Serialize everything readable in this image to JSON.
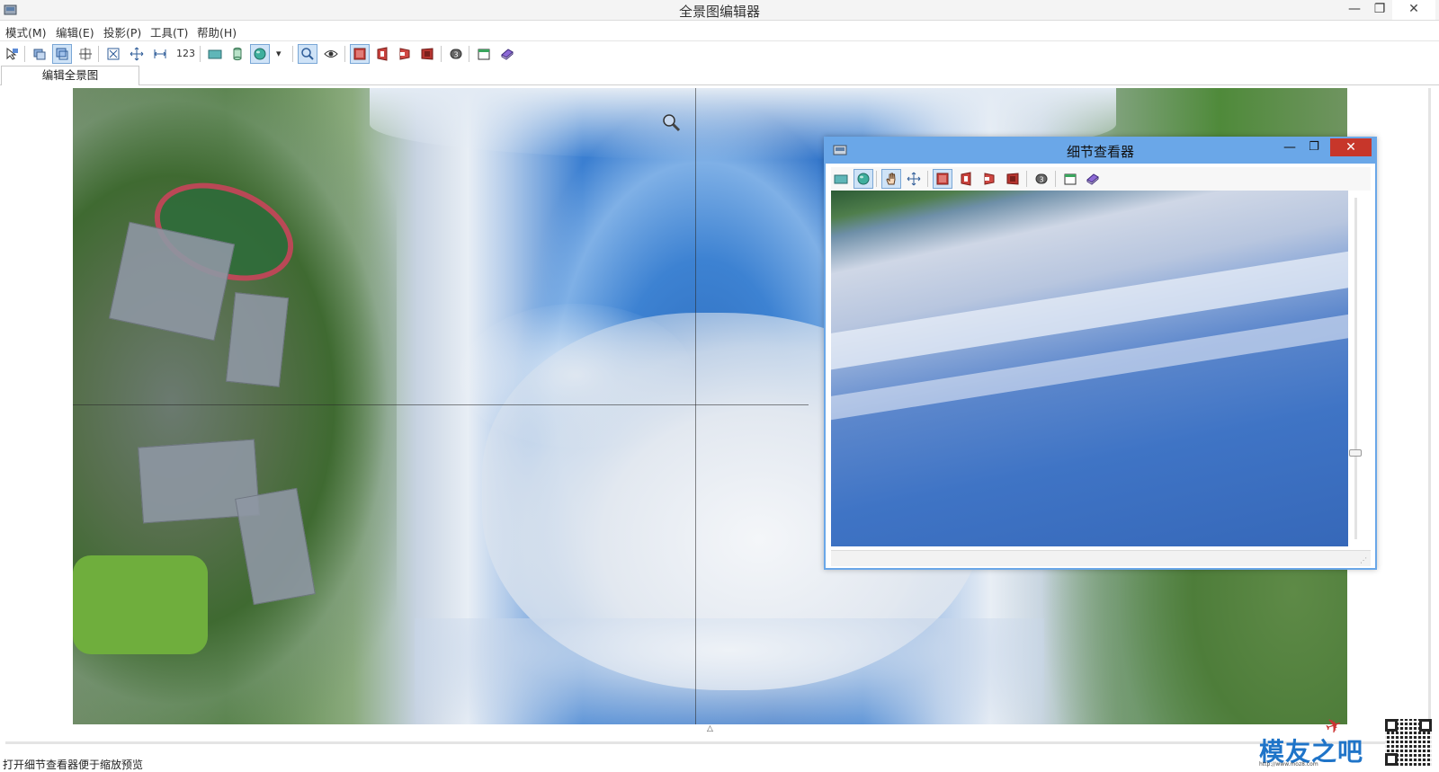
{
  "window": {
    "title": "全景图编辑器",
    "min_glyph": "—",
    "max_glyph": "❐",
    "close_glyph": "✕"
  },
  "menu": {
    "items": [
      {
        "label": "模式(M)"
      },
      {
        "label": "编辑(E)"
      },
      {
        "label": "投影(P)"
      },
      {
        "label": "工具(T)"
      },
      {
        "label": "帮助(H)"
      }
    ]
  },
  "toolbar": {
    "count_label": "123",
    "dropdown_glyph": "▾",
    "icons": [
      "pointer-select-icon",
      "layers-icon",
      "overlay-icon",
      "crosshair-grid-icon",
      "fit-view-icon",
      "move-arrows-icon",
      "spread-icon",
      "numbering-icon",
      "flat-projection-icon",
      "cylinder-projection-icon",
      "sphere-projection-icon",
      "projection-dropdown-icon",
      "zoom-icon",
      "eye-icon",
      "color-box-1-icon",
      "color-box-2-icon",
      "color-box-3-icon",
      "color-box-4-icon",
      "badge-3-icon",
      "window-green-icon",
      "book-icon"
    ],
    "accent_color": "#cfe3f7"
  },
  "tabs": [
    {
      "label": "编辑全景图",
      "active": true
    }
  ],
  "status": {
    "message": "打开细节查看器便于缩放预览"
  },
  "detail_viewer": {
    "title": "细节查看器",
    "min_glyph": "—",
    "max_glyph": "❐",
    "close_glyph": "✕",
    "title_color": "#6aa7e8",
    "close_color": "#c7362a",
    "icons": [
      "flat-projection-icon",
      "sphere-projection-icon",
      "hand-pan-icon",
      "move-arrows-icon",
      "color-box-1-icon",
      "color-box-2-icon",
      "color-box-3-icon",
      "color-box-4-icon",
      "badge-3-icon",
      "window-green-icon",
      "book-icon"
    ]
  },
  "watermark": {
    "logo_text": "模友之吧",
    "url": "http://www.moz8.com"
  }
}
